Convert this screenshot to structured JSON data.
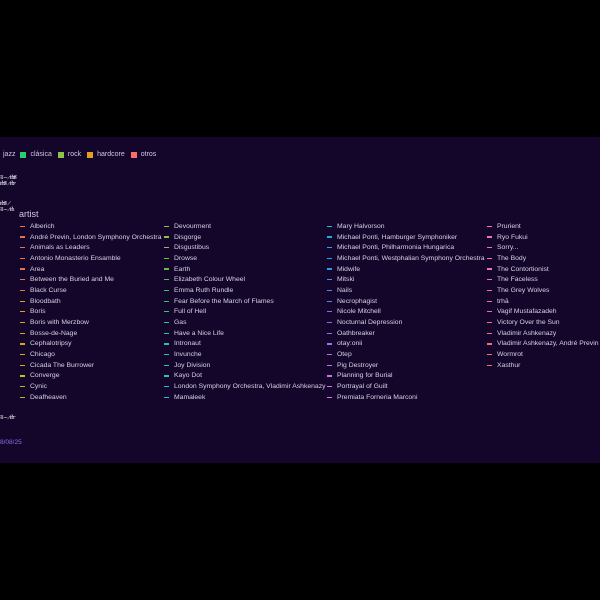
{
  "legend": {
    "title": "jazz",
    "items": [
      {
        "label": "jazz",
        "color": ""
      },
      {
        "label": "clásica",
        "color": "#2ecc71"
      },
      {
        "label": "rock",
        "color": "#8bc34a"
      },
      {
        "label": "hardcore",
        "color": "#e0a020"
      },
      {
        "label": "otros",
        "color": "#ff6b6b"
      }
    ]
  },
  "section_title": "artist",
  "date": "8/08/25",
  "colors": {
    "panel_bg": "#13062a",
    "accent": "#8a6fe6"
  },
  "columns": [
    {
      "items": [
        {
          "label": "Alberich",
          "color": "#e8704a"
        },
        {
          "label": "André Previn, London Symphony Orchestra",
          "color": "#e8704a"
        },
        {
          "label": "Animals as Leaders",
          "color": "#e8704a"
        },
        {
          "label": "Antonio Monasterio Ensamble",
          "color": "#e8704a"
        },
        {
          "label": "Area",
          "color": "#e8704a"
        },
        {
          "label": "Between the Buried and Me",
          "color": "#e8704a"
        },
        {
          "label": "Black Curse",
          "color": "#e8704a"
        },
        {
          "label": "Bloodbath",
          "color": "#e0a020"
        },
        {
          "label": "Boris",
          "color": "#e0a020"
        },
        {
          "label": "Boris with Merzbow",
          "color": "#e0a020"
        },
        {
          "label": "Bosse-de-Nage",
          "color": "#e0a020"
        },
        {
          "label": "Cephalotripsy",
          "color": "#e0a020"
        },
        {
          "label": "Chicago",
          "color": "#d4b020"
        },
        {
          "label": "Cicada The Burrower",
          "color": "#d4b020"
        },
        {
          "label": "Converge",
          "color": "#c0c020"
        },
        {
          "label": "Cynic",
          "color": "#a8c020"
        },
        {
          "label": "Deafheaven",
          "color": "#a8c020"
        }
      ]
    },
    {
      "items": [
        {
          "label": "Devourment",
          "color": "#8bc34a"
        },
        {
          "label": "Disgorge",
          "color": "#8bc34a"
        },
        {
          "label": "Disgustibus",
          "color": "#8bc34a"
        },
        {
          "label": "Drowse",
          "color": "#6cc040"
        },
        {
          "label": "Earth",
          "color": "#5cc040"
        },
        {
          "label": "Elizabeth Colour Wheel",
          "color": "#4cc050"
        },
        {
          "label": "Emma Ruth Rundle",
          "color": "#40c060"
        },
        {
          "label": "Fear Before the March of Flames",
          "color": "#30c070"
        },
        {
          "label": "Full of Hell",
          "color": "#2ecc71"
        },
        {
          "label": "Gas",
          "color": "#2ecc80"
        },
        {
          "label": "Have a Nice Life",
          "color": "#20c890"
        },
        {
          "label": "Intronaut",
          "color": "#20c8a0"
        },
        {
          "label": "Invunche",
          "color": "#20c8b0"
        },
        {
          "label": "Joy Division",
          "color": "#20c8b8"
        },
        {
          "label": "Kayo Dot",
          "color": "#20c8c0"
        },
        {
          "label": "London Symphony Orchestra, Vladimir Ashkenazy",
          "color": "#20c0c8"
        },
        {
          "label": "Mamaleek",
          "color": "#20c0d0"
        }
      ]
    },
    {
      "items": [
        {
          "label": "Mary Halvorson",
          "color": "#20b8d8"
        },
        {
          "label": "Michael Ponti, Hamburger Symphoniker",
          "color": "#20b0e0"
        },
        {
          "label": "Michael Ponti, Philharmonia Hungarica",
          "color": "#20a8e8"
        },
        {
          "label": "Michael Ponti, Westphalian Symphony Orchestra",
          "color": "#20a0f0"
        },
        {
          "label": "Midwife",
          "color": "#3098f0"
        },
        {
          "label": "Mitski",
          "color": "#4090f0"
        },
        {
          "label": "Nails",
          "color": "#5088f0"
        },
        {
          "label": "Necrophagist",
          "color": "#6080f0"
        },
        {
          "label": "Nicole Mitchell",
          "color": "#7078f0"
        },
        {
          "label": "Nocturnal Depression",
          "color": "#8070f0"
        },
        {
          "label": "Oathbreaker",
          "color": "#9070f0"
        },
        {
          "label": "otay:onii",
          "color": "#a070f0"
        },
        {
          "label": "Otep",
          "color": "#b070f0"
        },
        {
          "label": "Pig Destroyer",
          "color": "#c070f0"
        },
        {
          "label": "Planning for Burial",
          "color": "#d070e8"
        },
        {
          "label": "Portrayal of Guilt",
          "color": "#e070e0"
        },
        {
          "label": "Premiata Forneria Marconi",
          "color": "#e870d8"
        }
      ]
    },
    {
      "items": [
        {
          "label": "Prurient",
          "color": "#f070d0"
        },
        {
          "label": "Ryo Fukui",
          "color": "#f070c8"
        },
        {
          "label": "Sorry...",
          "color": "#f070c0"
        },
        {
          "label": "The Body",
          "color": "#f070b8"
        },
        {
          "label": "The Contortionist",
          "color": "#f070b0"
        },
        {
          "label": "The Faceless",
          "color": "#f070a8"
        },
        {
          "label": "The Grey Wolves",
          "color": "#f070a0"
        },
        {
          "label": "trhā",
          "color": "#f07098"
        },
        {
          "label": "Vagif Mustafazadeh",
          "color": "#f07090"
        },
        {
          "label": "Victory Over the Sun",
          "color": "#f07088"
        },
        {
          "label": "Vladimir Ashkenazy",
          "color": "#f07080"
        },
        {
          "label": "Vladimir Ashkenazy, André Previn",
          "color": "#f07078"
        },
        {
          "label": "Wormrot",
          "color": "#f07070"
        },
        {
          "label": "Xasthur",
          "color": "#f07068"
        }
      ]
    }
  ]
}
